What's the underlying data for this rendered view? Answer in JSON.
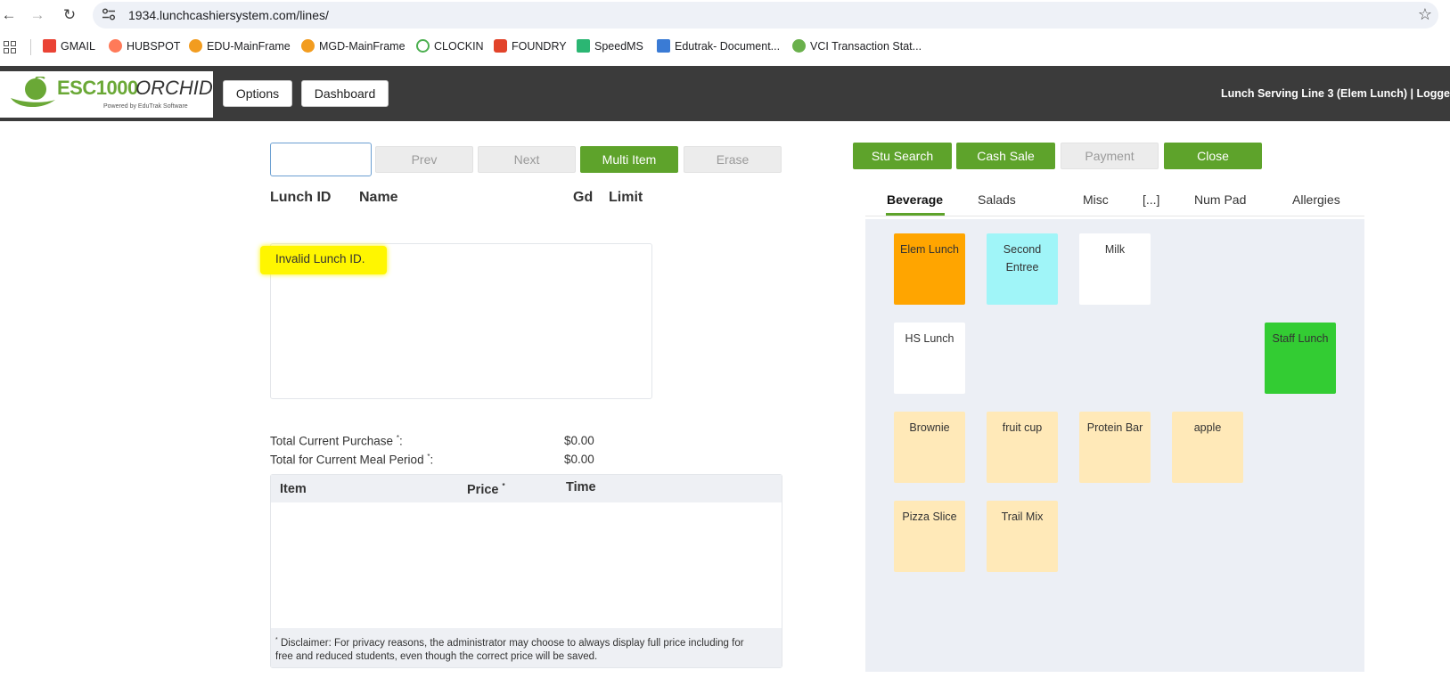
{
  "browser": {
    "url": "1934.lunchcashiersystem.com/lines/",
    "bookmarks": [
      {
        "label": "GMAIL",
        "color": "#ea4335"
      },
      {
        "label": "HUBSPOT",
        "color": "#ff7a59"
      },
      {
        "label": "EDU-MainFrame",
        "color": "#f29c1f"
      },
      {
        "label": "MGD-MainFrame",
        "color": "#f29c1f"
      },
      {
        "label": "CLOCKIN",
        "color": "#4caf50"
      },
      {
        "label": "FOUNDRY",
        "color": "#e2432a"
      },
      {
        "label": "SpeedMS",
        "color": "#2bb673"
      },
      {
        "label": "Edutrak- Document...",
        "color": "#3a7bd5"
      },
      {
        "label": "VCI Transaction Stat...",
        "color": "#6ab04c"
      }
    ]
  },
  "header": {
    "logo_main": "ESC1000",
    "logo_orchid": "ORCHID",
    "logo_sub": "Powered by EduTrak Software",
    "options_label": "Options",
    "dashboard_label": "Dashboard",
    "line_status": "Lunch Serving Line 3 (Elem Lunch) | Logge"
  },
  "left": {
    "prev_label": "Prev",
    "next_label": "Next",
    "multi_item_label": "Multi Item",
    "erase_label": "Erase",
    "columns": {
      "lunch_id": "Lunch ID",
      "name": "Name",
      "gd": "Gd",
      "limit": "Limit"
    },
    "message": "Invalid Lunch ID.",
    "total_current_purchase_label": "Total Current Purchase",
    "total_current_purchase_value": "$0.00",
    "total_meal_period_label": "Total for Current Meal Period",
    "total_meal_period_value": "$0.00",
    "asterisk": "*",
    "colon": ":",
    "items_columns": {
      "item": "Item",
      "price": "Price",
      "time": "Time"
    },
    "disclaimer_line1": "Disclaimer: For privacy reasons, the administrator may choose to always display full price including for",
    "disclaimer_line2": "free and reduced students, even though the correct price will be saved."
  },
  "right": {
    "stu_search_label": "Stu Search",
    "cash_sale_label": "Cash Sale",
    "payment_label": "Payment",
    "close_label": "Close",
    "tabs": [
      "Beverage",
      "Salads",
      "Misc",
      "[...]",
      "Num Pad",
      "Allergies"
    ],
    "active_tab": "Beverage",
    "tiles": [
      {
        "label": "Elem Lunch",
        "style": "orange"
      },
      {
        "label": "Second Entree",
        "style": "cyan"
      },
      {
        "label": "Milk",
        "style": "white"
      },
      {
        "label": "HS Lunch",
        "style": "white"
      },
      {
        "label": "Staff Lunch",
        "style": "green"
      },
      {
        "label": "Brownie",
        "style": "cream"
      },
      {
        "label": "fruit cup",
        "style": "cream"
      },
      {
        "label": "Protein Bar",
        "style": "cream"
      },
      {
        "label": "apple",
        "style": "cream"
      },
      {
        "label": "Pizza Slice",
        "style": "cream"
      },
      {
        "label": "Trail Mix",
        "style": "cream"
      }
    ]
  }
}
